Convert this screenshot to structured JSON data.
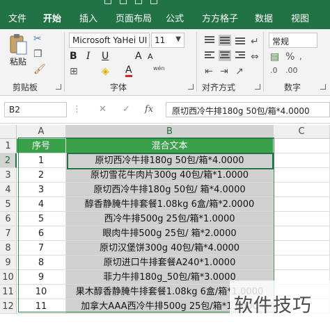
{
  "menu": {
    "tabs": [
      "文件",
      "开始",
      "插入",
      "页面布局",
      "公式",
      "方方格子",
      "数据",
      "视图"
    ],
    "active_tab": "开始"
  },
  "ribbon": {
    "clipboard": {
      "paste_label": "粘贴",
      "group_label": "剪贴板"
    },
    "font": {
      "font_name": "Microsoft YaHei UI",
      "font_size": "11",
      "bold": "B",
      "italic": "I",
      "underline": "U",
      "grow": "A",
      "shrink": "A",
      "font_color_glyph": "A",
      "phonetic_glyph": "wén",
      "group_label": "字体"
    },
    "alignment": {
      "group_label": "对齐方式"
    },
    "number": {
      "format_name": "常规",
      "group_label": "数字"
    }
  },
  "formula_bar": {
    "name_box": "B2",
    "cancel_glyph": "✕",
    "enter_glyph": "✓",
    "fx_glyph": "fx",
    "formula": "原切西冷牛排180g 50包/箱*4.0000"
  },
  "grid": {
    "columns": [
      "A",
      "B",
      "C"
    ],
    "selected_column": "B",
    "rows": [
      "1",
      "2",
      "3",
      "4",
      "5",
      "6",
      "7",
      "8",
      "9",
      "10",
      "11",
      "12"
    ],
    "selected_row": "2",
    "header": {
      "seq": "序号",
      "text": "混合文本"
    },
    "data": [
      {
        "seq": "1",
        "text": "原切西冷牛排180g 50包/箱*4.0000"
      },
      {
        "seq": "2",
        "text": "原切雪花牛肉片300g 40包/箱*1.0000"
      },
      {
        "seq": "3",
        "text": "原切西冷牛排180g 50包/ 箱*4.0000"
      },
      {
        "seq": "4",
        "text": "醇香静腌牛排套餐1.08kg 6盒/箱*2.0000"
      },
      {
        "seq": "5",
        "text": "西冷牛排500g 25包/箱*1.0000"
      },
      {
        "seq": "6",
        "text": "眼肉牛排500g 25包/ 箱*2.0000"
      },
      {
        "seq": "7",
        "text": "原切汉堡饼300g 40包/箱*4.0000"
      },
      {
        "seq": "8",
        "text": "原切进口牛排套餐A240*1.0000"
      },
      {
        "seq": "9",
        "text": "菲力牛排180g_50包/箱*3.0000"
      },
      {
        "seq": "10",
        "text": "果木醇香静腌牛排套餐1.08kg 6盒/箱*1.0000"
      },
      {
        "seq": "11",
        "text": "加拿大AAA西冷牛排500g 25包/箱*1.0000"
      }
    ]
  },
  "watermark": "软件技巧",
  "colors": {
    "excel_green": "#217346",
    "header_fill": "#3aa04a",
    "text_fill": "#d0d0d0"
  }
}
